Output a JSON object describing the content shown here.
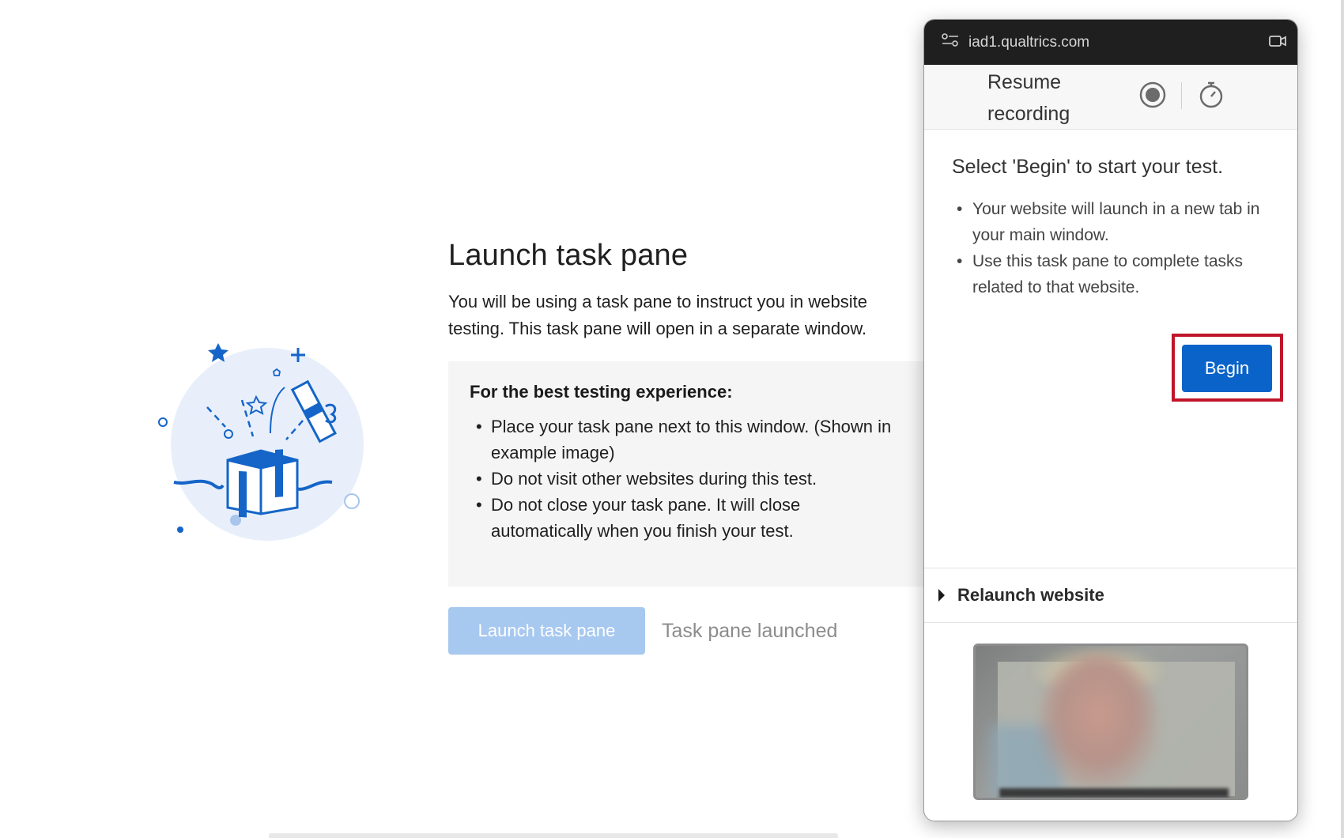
{
  "main": {
    "title": "Launch task pane",
    "description": "You will be using a task pane to instruct you in website testing. This task pane will open in a separate window.",
    "tips": {
      "title": "For the best testing experience:",
      "items": [
        "Place your task pane next to this window. (Shown in example image)",
        "Do not visit other websites during this test.",
        "Do not close your task pane. It will close automatically when you finish your test."
      ]
    },
    "launch_button_label": "Launch task pane",
    "launched_status": "Task pane launched"
  },
  "task_pane": {
    "url": "iad1.qualtrics.com",
    "resume_recording_label": "Resume recording",
    "heading": "Select 'Begin' to start your test.",
    "items": [
      "Your website will launch in a new tab in your main window.",
      "Use this task pane to complete tasks related to that website."
    ],
    "begin_button_label": "Begin",
    "relaunch_label": "Relaunch website"
  },
  "colors": {
    "primary_blue": "#0a63c9",
    "disabled_blue": "#a7c8ef",
    "highlight_red": "#c0142a",
    "illustration_bg": "#e8effb"
  },
  "icons": {
    "titlebar_left": "site-controls-icon",
    "titlebar_right": "camera-icon",
    "record": "record-icon",
    "timer": "stopwatch-icon",
    "relaunch": "caret-right-icon"
  }
}
